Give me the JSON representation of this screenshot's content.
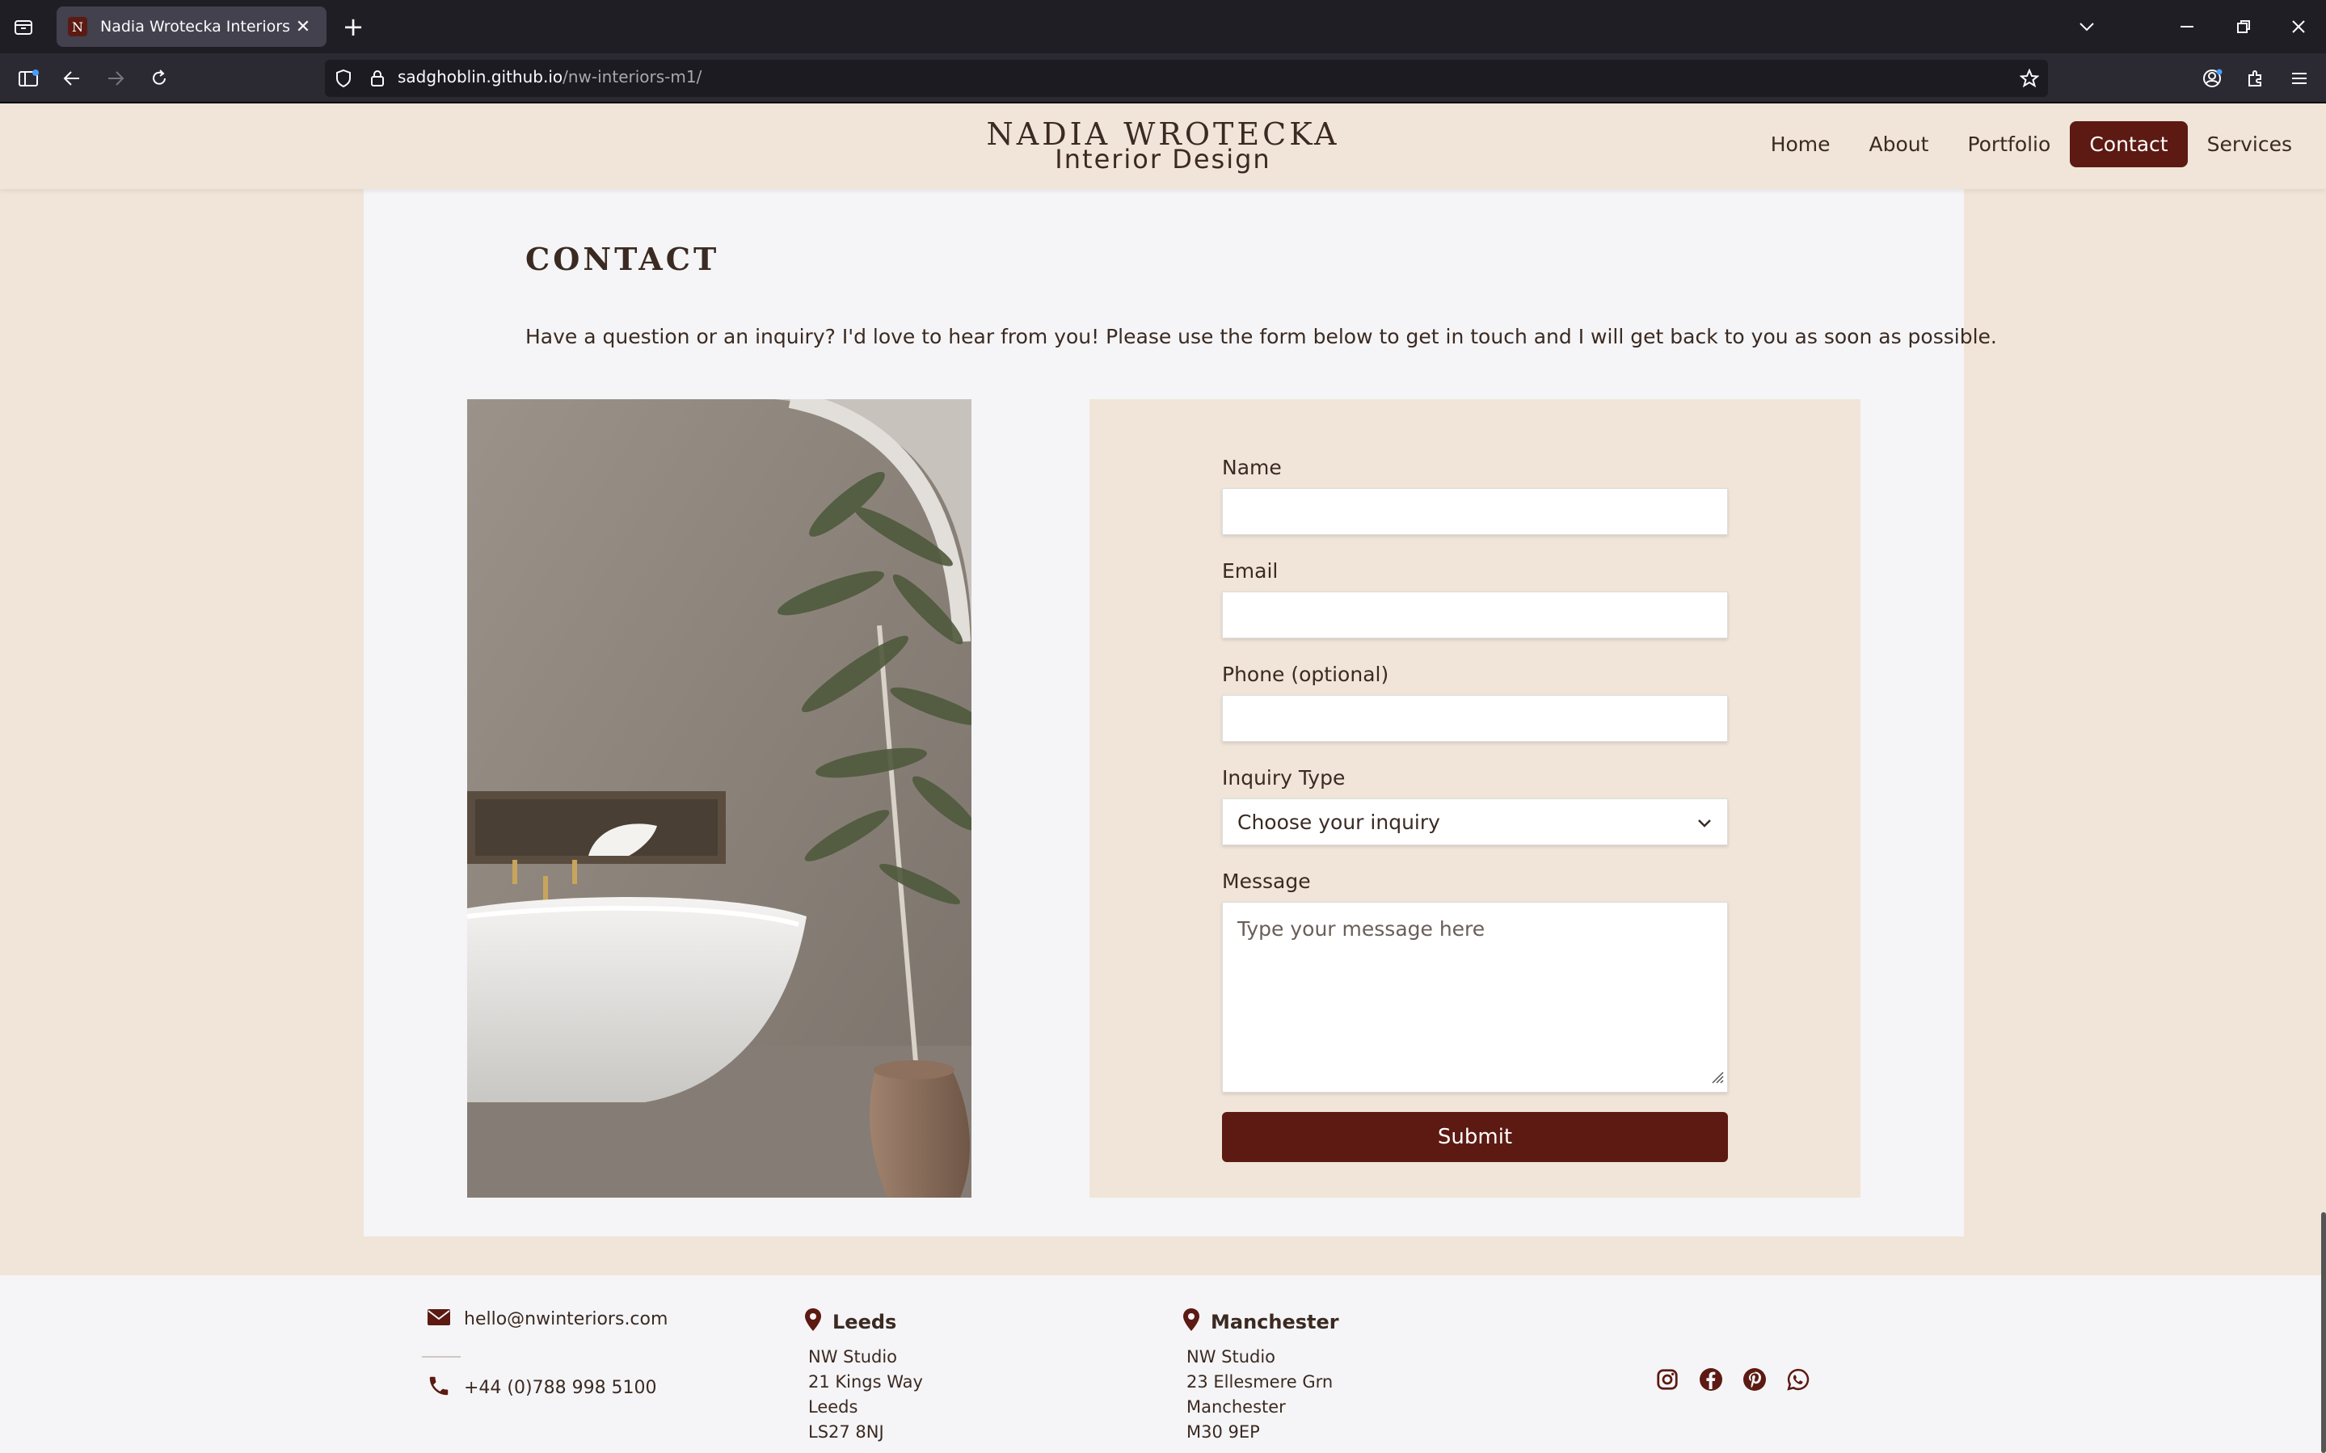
{
  "browser": {
    "tab_title": "Nadia Wrotecka Interiors",
    "tab_favicon_letter": "N",
    "url_domain": "sadghoblin.github.io",
    "url_path": "/nw-interiors-m1/"
  },
  "header": {
    "brand_name": "NADIA WROTECKA",
    "brand_sub": "Interior Design",
    "nav": [
      {
        "label": "Home",
        "active": false
      },
      {
        "label": "About",
        "active": false
      },
      {
        "label": "Portfolio",
        "active": false
      },
      {
        "label": "Contact",
        "active": true
      },
      {
        "label": "Services",
        "active": false
      }
    ]
  },
  "main": {
    "title": "CONTACT",
    "intro": "Have a question or an inquiry? I'd love to hear from you! Please use the form below to get in touch and I will get back to you as soon as possible."
  },
  "form": {
    "name_label": "Name",
    "email_label": "Email",
    "phone_label": "Phone (optional)",
    "inquiry_label": "Inquiry Type",
    "inquiry_selected": "Choose your inquiry",
    "message_label": "Message",
    "message_placeholder": "Type your message here",
    "submit_label": "Submit"
  },
  "footer": {
    "email": "hello@nwinteriors.com",
    "phone": "+44 (0)788 998 5100",
    "locations": [
      {
        "city": "Leeds",
        "lines": [
          "NW Studio",
          "21 Kings Way",
          "Leeds",
          "LS27 8NJ"
        ]
      },
      {
        "city": "Manchester",
        "lines": [
          "NW Studio",
          "23 Ellesmere Grn",
          "Manchester",
          "M30 9EP"
        ]
      }
    ],
    "socials": [
      "instagram-icon",
      "facebook-icon",
      "pinterest-icon",
      "whatsapp-icon"
    ]
  },
  "colors": {
    "accent": "#5c1a12",
    "background": "#f0e5d8",
    "card": "#f5f5f7",
    "text": "#3b2a22"
  }
}
